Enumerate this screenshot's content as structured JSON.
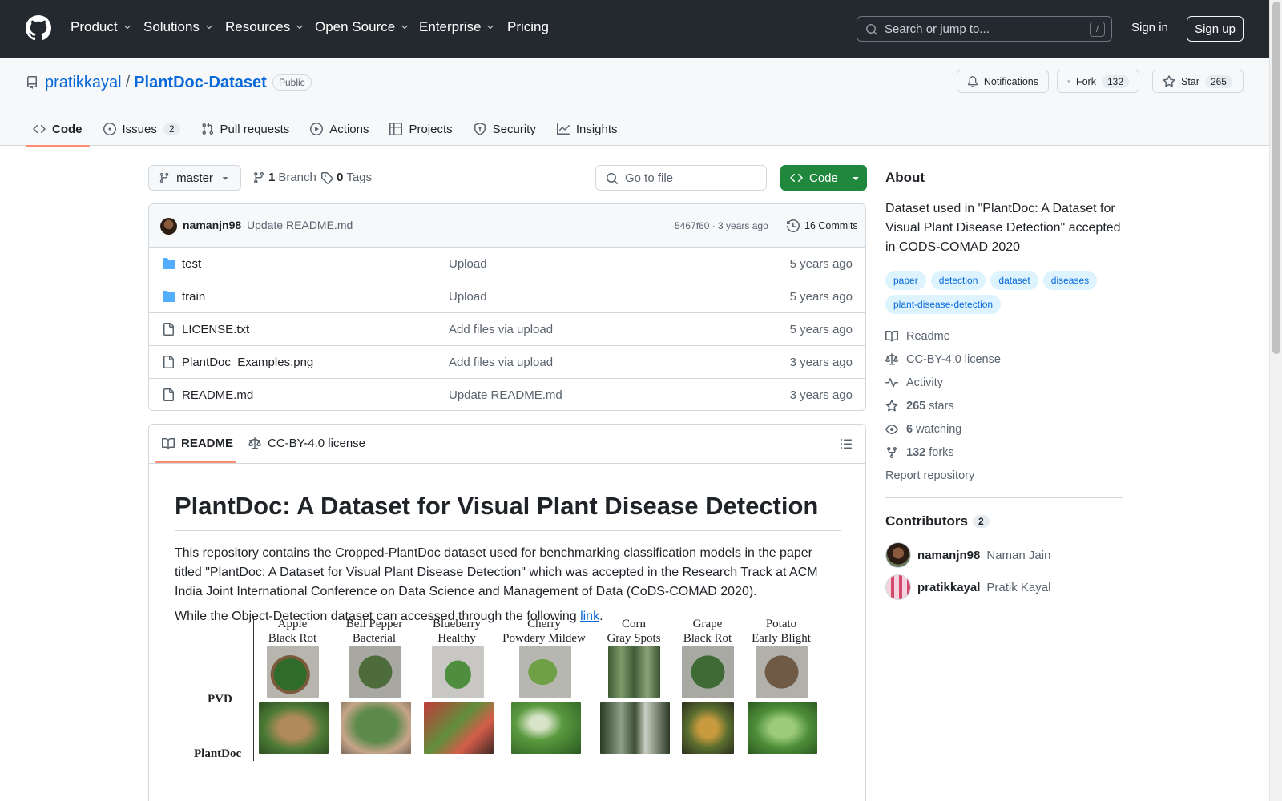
{
  "header": {
    "nav": [
      {
        "label": "Product",
        "dropdown": true
      },
      {
        "label": "Solutions",
        "dropdown": true
      },
      {
        "label": "Resources",
        "dropdown": true
      },
      {
        "label": "Open Source",
        "dropdown": true
      },
      {
        "label": "Enterprise",
        "dropdown": true
      },
      {
        "label": "Pricing",
        "dropdown": false
      }
    ],
    "search_placeholder": "Search or jump to...",
    "search_shortcut": "/",
    "signin": "Sign in",
    "signup": "Sign up"
  },
  "repo": {
    "owner": "pratikkayal",
    "separator": "/",
    "name": "PlantDoc-Dataset",
    "visibility": "Public",
    "notifications": "Notifications",
    "fork_label": "Fork",
    "fork_count": "132",
    "star_label": "Star",
    "star_count": "265"
  },
  "tabs": [
    {
      "label": "Code",
      "icon": "code-icon",
      "active": true
    },
    {
      "label": "Issues",
      "icon": "issue-icon",
      "count": "2"
    },
    {
      "label": "Pull requests",
      "icon": "pull-request-icon"
    },
    {
      "label": "Actions",
      "icon": "play-icon"
    },
    {
      "label": "Projects",
      "icon": "table-icon"
    },
    {
      "label": "Security",
      "icon": "shield-icon"
    },
    {
      "label": "Insights",
      "icon": "graph-icon"
    }
  ],
  "toolbar": {
    "branch": "master",
    "branches_count": "1",
    "branches_label": "Branch",
    "tags_count": "0",
    "tags_label": "Tags",
    "goto_placeholder": "Go to file",
    "code_button": "Code"
  },
  "commit": {
    "author": "namanjn98",
    "message": "Update README.md",
    "hash_time": "5467f60 · 3 years ago",
    "commits": "16 Commits"
  },
  "files": [
    {
      "type": "folder",
      "name": "test",
      "message": "Upload",
      "age": "5 years ago"
    },
    {
      "type": "folder",
      "name": "train",
      "message": "Upload",
      "age": "5 years ago"
    },
    {
      "type": "file",
      "name": "LICENSE.txt",
      "message": "Add files via upload",
      "age": "5 years ago"
    },
    {
      "type": "file",
      "name": "PlantDoc_Examples.png",
      "message": "Add files via upload",
      "age": "3 years ago"
    },
    {
      "type": "file",
      "name": "README.md",
      "message": "Update README.md",
      "age": "3 years ago"
    }
  ],
  "readme": {
    "tab_readme": "README",
    "tab_license": "CC-BY-4.0 license",
    "title": "PlantDoc: A Dataset for Visual Plant Disease Detection",
    "para1": "This repository contains the Cropped-PlantDoc dataset used for benchmarking classification models in the paper titled \"PlantDoc: A Dataset for Visual Plant Disease Detection\" which was accepted in the Research Track at ACM India Joint International Conference on Data Science and Management of Data (CoDS-COMAD 2020).",
    "para2_prefix": "While the Object-Detection dataset can accessed through the following ",
    "para2_link": "link",
    "para2_suffix": ".",
    "figure": {
      "row_labels": [
        "PVD",
        "PlantDoc"
      ],
      "columns": [
        {
          "line1": "Apple",
          "line2": "Black Rot"
        },
        {
          "line1": "Bell Pepper",
          "line2": "Bacterial"
        },
        {
          "line1": "Blueberry",
          "line2": "Healthy"
        },
        {
          "line1": "Cherry",
          "line2": "Powdery Mildew"
        },
        {
          "line1": "Corn",
          "line2": "Gray Spots"
        },
        {
          "line1": "Grape",
          "line2": "Black Rot"
        },
        {
          "line1": "Potato",
          "line2": "Early Blight"
        }
      ]
    }
  },
  "about": {
    "heading": "About",
    "description": "Dataset used in \"PlantDoc: A Dataset for Visual Plant Disease Detection\" accepted in CODS-COMAD 2020",
    "topics": [
      "paper",
      "detection",
      "dataset",
      "diseases",
      "plant-disease-detection"
    ],
    "readme": "Readme",
    "license": "CC-BY-4.0 license",
    "activity": "Activity",
    "stars_count": "265",
    "stars_label": "stars",
    "watching_count": "6",
    "watching_label": "watching",
    "forks_count": "132",
    "forks_label": "forks",
    "report": "Report repository"
  },
  "contributors": {
    "heading": "Contributors",
    "count": "2",
    "list": [
      {
        "login": "namanjn98",
        "name": "Naman Jain"
      },
      {
        "login": "pratikkayal",
        "name": "Pratik Kayal"
      }
    ]
  }
}
